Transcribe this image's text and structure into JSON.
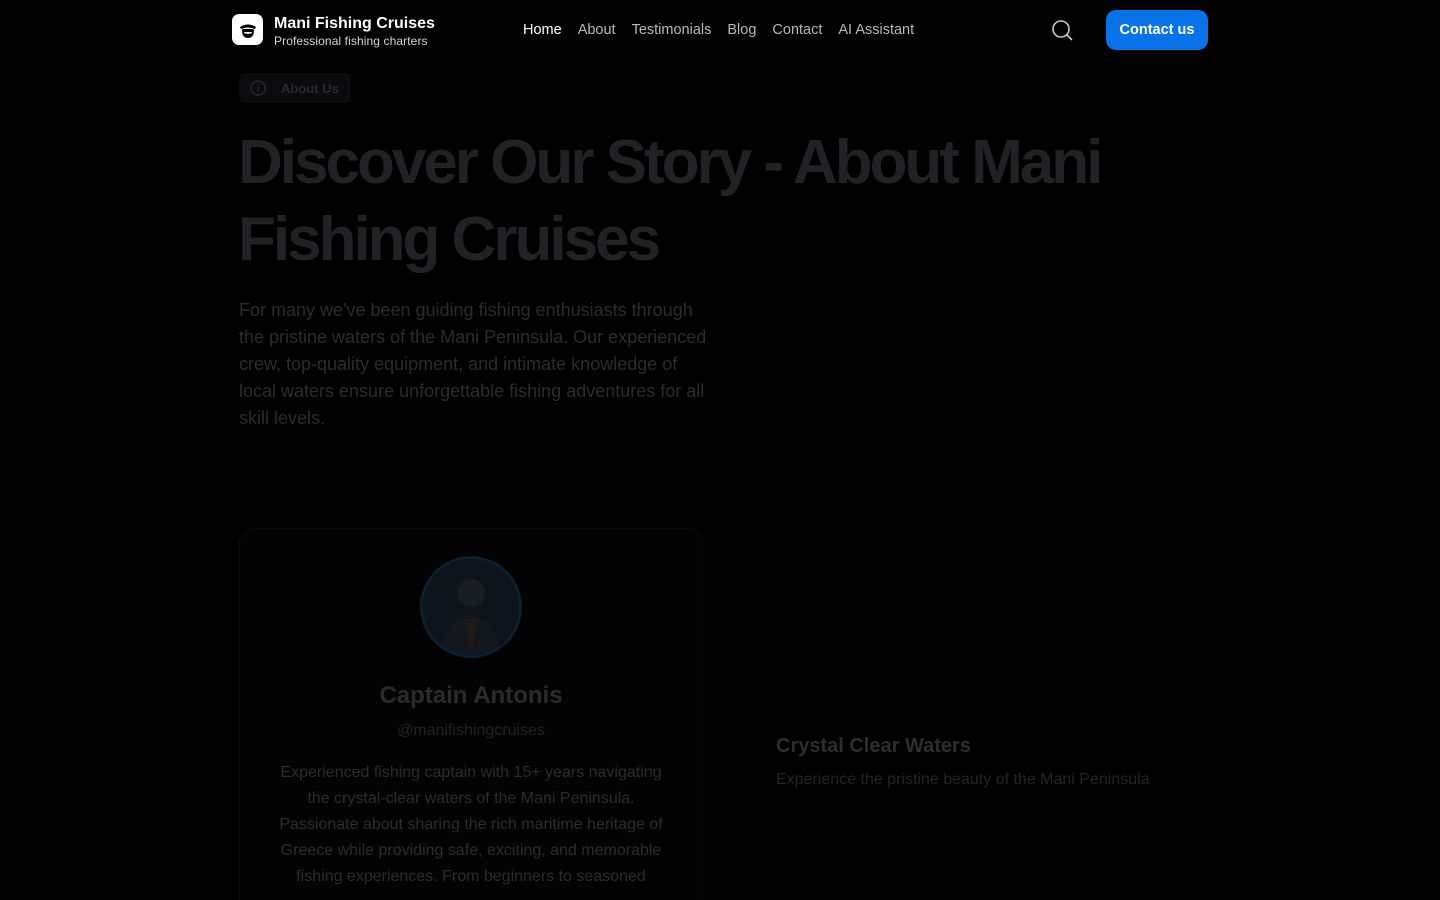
{
  "header": {
    "brand_name": "Mani Fishing Cruises",
    "brand_tagline": "Professional fishing charters",
    "nav": [
      {
        "label": "Home",
        "active": true
      },
      {
        "label": "About",
        "active": false
      },
      {
        "label": "Testimonials",
        "active": false
      },
      {
        "label": "Blog",
        "active": false
      },
      {
        "label": "Contact",
        "active": false
      },
      {
        "label": "AI Assistant",
        "active": false
      }
    ],
    "search_icon": "search-icon",
    "cta_label": "Contact us"
  },
  "hero": {
    "badge_label": "About Us",
    "badge_icon": "info-icon",
    "title": "Discover Our Story - About Mani Fishing Cruises",
    "description": "For many we've been guiding fishing enthusiasts through the pristine waters of the Mani Peninsula. Our experienced crew, top-quality equipment, and intimate knowledge of local waters ensure unforgettable fishing adventures for all skill levels."
  },
  "profile_card": {
    "name": "Captain Antonis",
    "handle": "@manifishingcruises",
    "bio": "Experienced fishing captain with 15+ years navigating the crystal-clear waters of the Mani Peninsula. Passionate about sharing the rich maritime heritage of Greece while providing safe, exciting, and memorable fishing experiences. From beginners to seasoned"
  },
  "feature": {
    "title": "Crystal Clear Waters",
    "description": "Experience the pristine beauty of the Mani Peninsula"
  },
  "colors": {
    "background": "#000000",
    "accent": "#0a72e8",
    "nav_inactive": "#b8b8b8",
    "text_primary": "#ffffff"
  }
}
